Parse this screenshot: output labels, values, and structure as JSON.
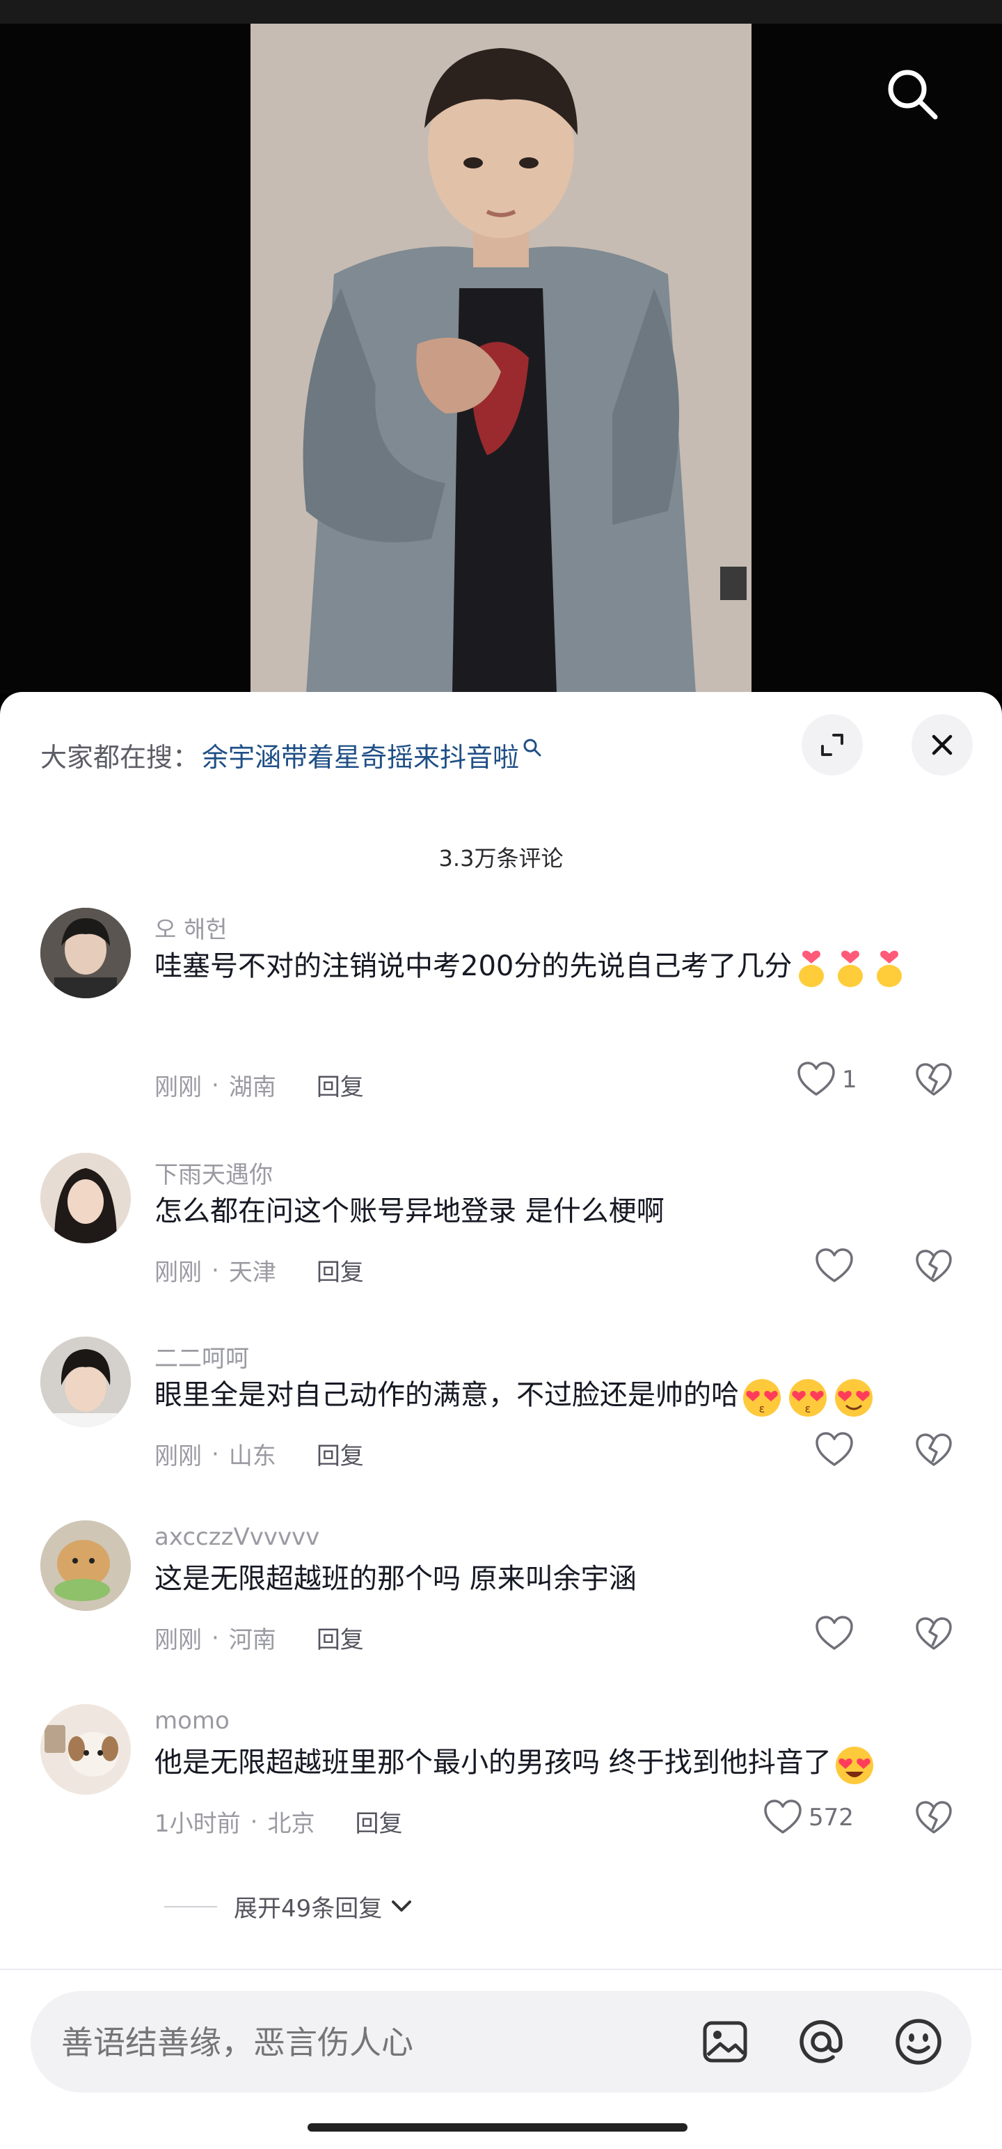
{
  "hot_search": {
    "label": "大家都在搜：",
    "query": "余宇涵带着星奇摇来抖音啦"
  },
  "comments_header": {
    "count_label": "3.3万条评论"
  },
  "comments": [
    {
      "name": "오 해헌",
      "text": "哇塞号不对的注销说中考200分的先说自己考了几分",
      "emoji": [
        "finger-heart-emoji",
        "finger-heart-emoji",
        "finger-heart-emoji"
      ],
      "time": "刚刚",
      "location": "湖南",
      "reply_label": "回复",
      "likes": "1"
    },
    {
      "name": "下雨天遇你",
      "text": "怎么都在问这个账号异地登录 是什么梗啊",
      "time": "刚刚",
      "location": "天津",
      "reply_label": "回复",
      "likes": ""
    },
    {
      "name": "二二呵呵",
      "text": "眼里全是对自己动作的满意，不过脸还是帅的哈",
      "emoji": [
        "kissing-heart-emoji",
        "kissing-heart-emoji",
        "heart-eyes-emoji"
      ],
      "time": "刚刚",
      "location": "山东",
      "reply_label": "回复",
      "likes": ""
    },
    {
      "name": "axcczzVvvvvv",
      "text": "这是无限超越班的那个吗 原来叫余宇涵",
      "time": "刚刚",
      "location": "河南",
      "reply_label": "回复",
      "likes": ""
    },
    {
      "name": "momo",
      "text": "他是无限超越班里那个最小的男孩吗 终于找到他抖音了",
      "emoji": [
        "star-struck-emoji"
      ],
      "time": "1小时前",
      "location": "北京",
      "reply_label": "回复",
      "likes": "572"
    }
  ],
  "expand_replies": {
    "label": "展开49条回复"
  },
  "input": {
    "placeholder": "善语结善缘，恶言伤人心"
  },
  "icons": {
    "search": "search-icon",
    "expand": "expand-icon",
    "close": "close-icon",
    "like": "heart-outline-icon",
    "dislike": "broken-heart-icon",
    "image": "image-icon",
    "mention": "at-icon",
    "emoji": "smiley-icon",
    "chevron": "chevron-down-icon"
  },
  "colors": {
    "link": "#1f4f86",
    "muted": "#9a9aa2",
    "text": "#161823",
    "sheet_bg": "#ffffff",
    "video_bg": "#050505"
  }
}
